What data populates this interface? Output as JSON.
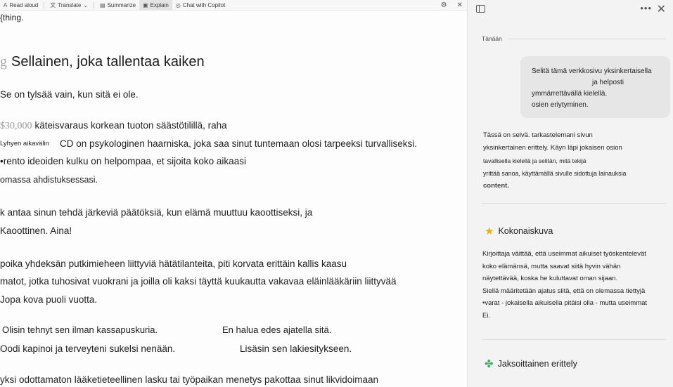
{
  "toolbar": {
    "items": [
      {
        "label": "Read aloud",
        "icon": "speaker-icon"
      },
      {
        "label": "Translate",
        "icon": "translate-icon"
      },
      {
        "label": "Summarize",
        "icon": "summarize-icon"
      },
      {
        "label": "Explain",
        "icon": "explain-icon",
        "active": true
      },
      {
        "label": "Chat with Copilot",
        "icon": "copilot-icon"
      }
    ]
  },
  "article": {
    "top_fragment": "{thing.",
    "heading_glyph": "g",
    "heading": "Sellainen, joka tallentaa kaiken",
    "p1": "Se on tylsää vain, kun sitä ei ole.",
    "money": "$30,000",
    "p2": "käteisvaraus korkean tuoton säästötilillä, raha",
    "p3_label": "Lyhyen aikavälin",
    "p3": "CD on psykologinen haarniska, joka saa sinut tuntemaan olosi tarpeeksi turvalliseksi.",
    "p4": "•rento ideoiden kulku on helpompaa, et sijoita koko aikaasi",
    "p5": "omassa ahdistuksessasi.",
    "p6": "k antaa sinun tehdä järkeviä päätöksiä, kun elämä muuttuu kaoottiseksi, ja",
    "p7": "Kaoottinen. Aina!",
    "p8": "poika yhdeksän putkimieheen liittyviä hätätilanteita, piti korvata erittäin kallis kaasu",
    "p9": "matot, jotka tuhosivat vuokrani ja joilla oli kaksi täyttä kuukautta vakavaa eläinlääkäriin liittyvää",
    "p10": "Jopa kova puoli vuotta.",
    "p11a": "Olisin tehnyt sen ilman kassapuskuria.",
    "p11b": "En halua edes ajatella sitä.",
    "p12a": "Oodi kapinoi ja terveyteni sukelsi nenään.",
    "p12b": "Lisäsin sen lakiesitykseen.",
    "p13": "yksi odottamaton lääketieteellinen lasku tai työpaikan menetys pakottaa sinut likvidoimaan"
  },
  "panel": {
    "day_label": "Tänään",
    "user_message": [
      "Selitä tämä verkkosivu yksinkertaisella",
      "ja helposti",
      "ymmärrettävällä kielellä.",
      "osien eriytyminen."
    ],
    "reply": [
      "Tässä on selvä. tarkastelemani sivun",
      "yksinkertainen erittely. Käyn läpi jokaisen osion",
      "tavallisella kielellä ja selitän, mitä tekijä",
      "yrittää sanoa, käyttämällä sivulle sidottuja lainauksia",
      "content."
    ],
    "section1_title": "Kokonaiskuva",
    "section1_text": [
      "Kirjoittaja väittää, että useimmat aikuiset työskentelevät",
      "koko elämänsä, mutta saavat siitä hyvin vähän",
      "näytettävää, koska he kuluttavat oman sijaan.",
      "Siellä määritetään ajatus siitä, että on olemassa tiettyjä",
      "•varat - jokaisella aikuisella pitäisi olla - mutta useimmat",
      "Ei."
    ],
    "section2_title": "Jaksoittainen erittely"
  }
}
